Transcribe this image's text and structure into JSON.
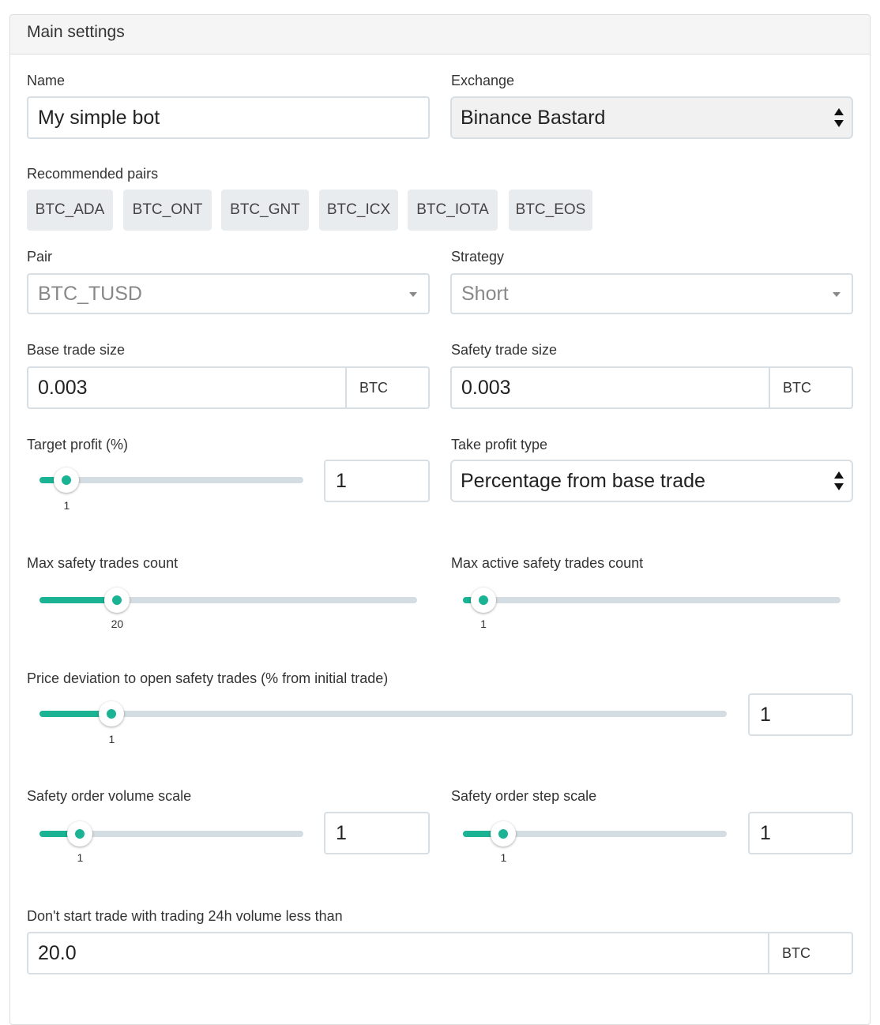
{
  "panel": {
    "title": "Main settings"
  },
  "name": {
    "label": "Name",
    "value": "My simple bot"
  },
  "exchange": {
    "label": "Exchange",
    "value": "Binance Bastard"
  },
  "recommended": {
    "label": "Recommended pairs",
    "pairs": [
      "BTC_ADA",
      "BTC_ONT",
      "BTC_GNT",
      "BTC_ICX",
      "BTC_IOTA",
      "BTC_EOS"
    ]
  },
  "pair": {
    "label": "Pair",
    "value": "BTC_TUSD"
  },
  "strategy": {
    "label": "Strategy",
    "value": "Short"
  },
  "base_trade": {
    "label": "Base trade size",
    "value": "0.003",
    "unit": "BTC"
  },
  "safety_trade": {
    "label": "Safety trade size",
    "value": "0.003",
    "unit": "BTC"
  },
  "target_profit": {
    "label": "Target profit (%)",
    "slider_value": "1",
    "input_value": "1",
    "fraction": 0.03
  },
  "take_profit_type": {
    "label": "Take profit type",
    "value": "Percentage from base trade"
  },
  "max_safety": {
    "label": "Max safety trades count",
    "slider_value": "20",
    "fraction": 0.17
  },
  "max_active_safety": {
    "label": "Max active safety trades count",
    "slider_value": "1",
    "fraction": 0.0
  },
  "price_deviation": {
    "label": "Price deviation to open safety trades (% from initial trade)",
    "slider_value": "1",
    "input_value": "1",
    "fraction": 0.08
  },
  "volume_scale": {
    "label": "Safety order volume scale",
    "slider_value": "1",
    "input_value": "1",
    "fraction": 0.09
  },
  "step_scale": {
    "label": "Safety order step scale",
    "slider_value": "1",
    "input_value": "1",
    "fraction": 0.09
  },
  "min_volume": {
    "label": "Don't start trade with trading 24h volume less than",
    "value": "20.0",
    "unit": "BTC"
  },
  "colors": {
    "accent": "#1ab394",
    "track": "#d4dde2",
    "border": "#d8dfe4",
    "pair_bg": "#e9ecef"
  }
}
